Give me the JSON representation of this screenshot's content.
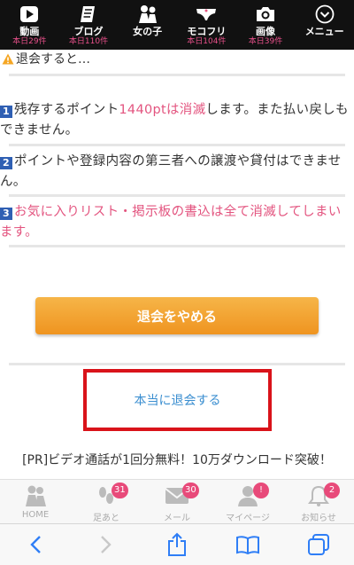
{
  "topnav": {
    "items": [
      {
        "label": "動画",
        "count": "本日29件",
        "icon": "play-icon"
      },
      {
        "label": "ブログ",
        "count": "本日110件",
        "icon": "notebook-icon"
      },
      {
        "label": "女の子",
        "count": "",
        "icon": "girls-icon"
      },
      {
        "label": "モコフリ",
        "count": "本日104件",
        "icon": "underwear-icon"
      },
      {
        "label": "画像",
        "count": "本日39件",
        "icon": "camera-icon"
      },
      {
        "label": "メニュー",
        "count": "",
        "icon": "chevron-circle-icon"
      }
    ]
  },
  "notice": {
    "heading": "退会すると…",
    "items": [
      {
        "num": "1",
        "pre": "残存するポイント",
        "highlight": "1440ptは消滅",
        "post": "します。また払い戻しもできません。"
      },
      {
        "num": "2",
        "text": "ポイントや登録内容の第三者への譲渡や貸付はできません。"
      },
      {
        "num": "3",
        "text": "お気に入りリスト・掲示板の書込は全て消滅してしまいます。"
      }
    ]
  },
  "buttons": {
    "stop": "退会をやめる",
    "confirm": "本当に退会する"
  },
  "pr_text": "[PR]ビデオ通話が1回分無料！10万ダウンロード突破！",
  "tabbar": {
    "tabs": [
      {
        "label": "HOME",
        "badge": "",
        "icon": "home-icon"
      },
      {
        "label": "足あと",
        "badge": "31",
        "icon": "footprint-icon"
      },
      {
        "label": "メール",
        "badge": "30",
        "icon": "mail-icon"
      },
      {
        "label": "マイページ",
        "badge": "!",
        "icon": "user-icon"
      },
      {
        "label": "お知らせ",
        "badge": "2",
        "icon": "bell-icon"
      }
    ]
  },
  "colors": {
    "accent_pink": "#e3547f",
    "number_blue": "#2f5fb3",
    "button_orange": "#ef9420",
    "highlight_red": "#d9131a",
    "link_blue": "#3a8ed0"
  }
}
